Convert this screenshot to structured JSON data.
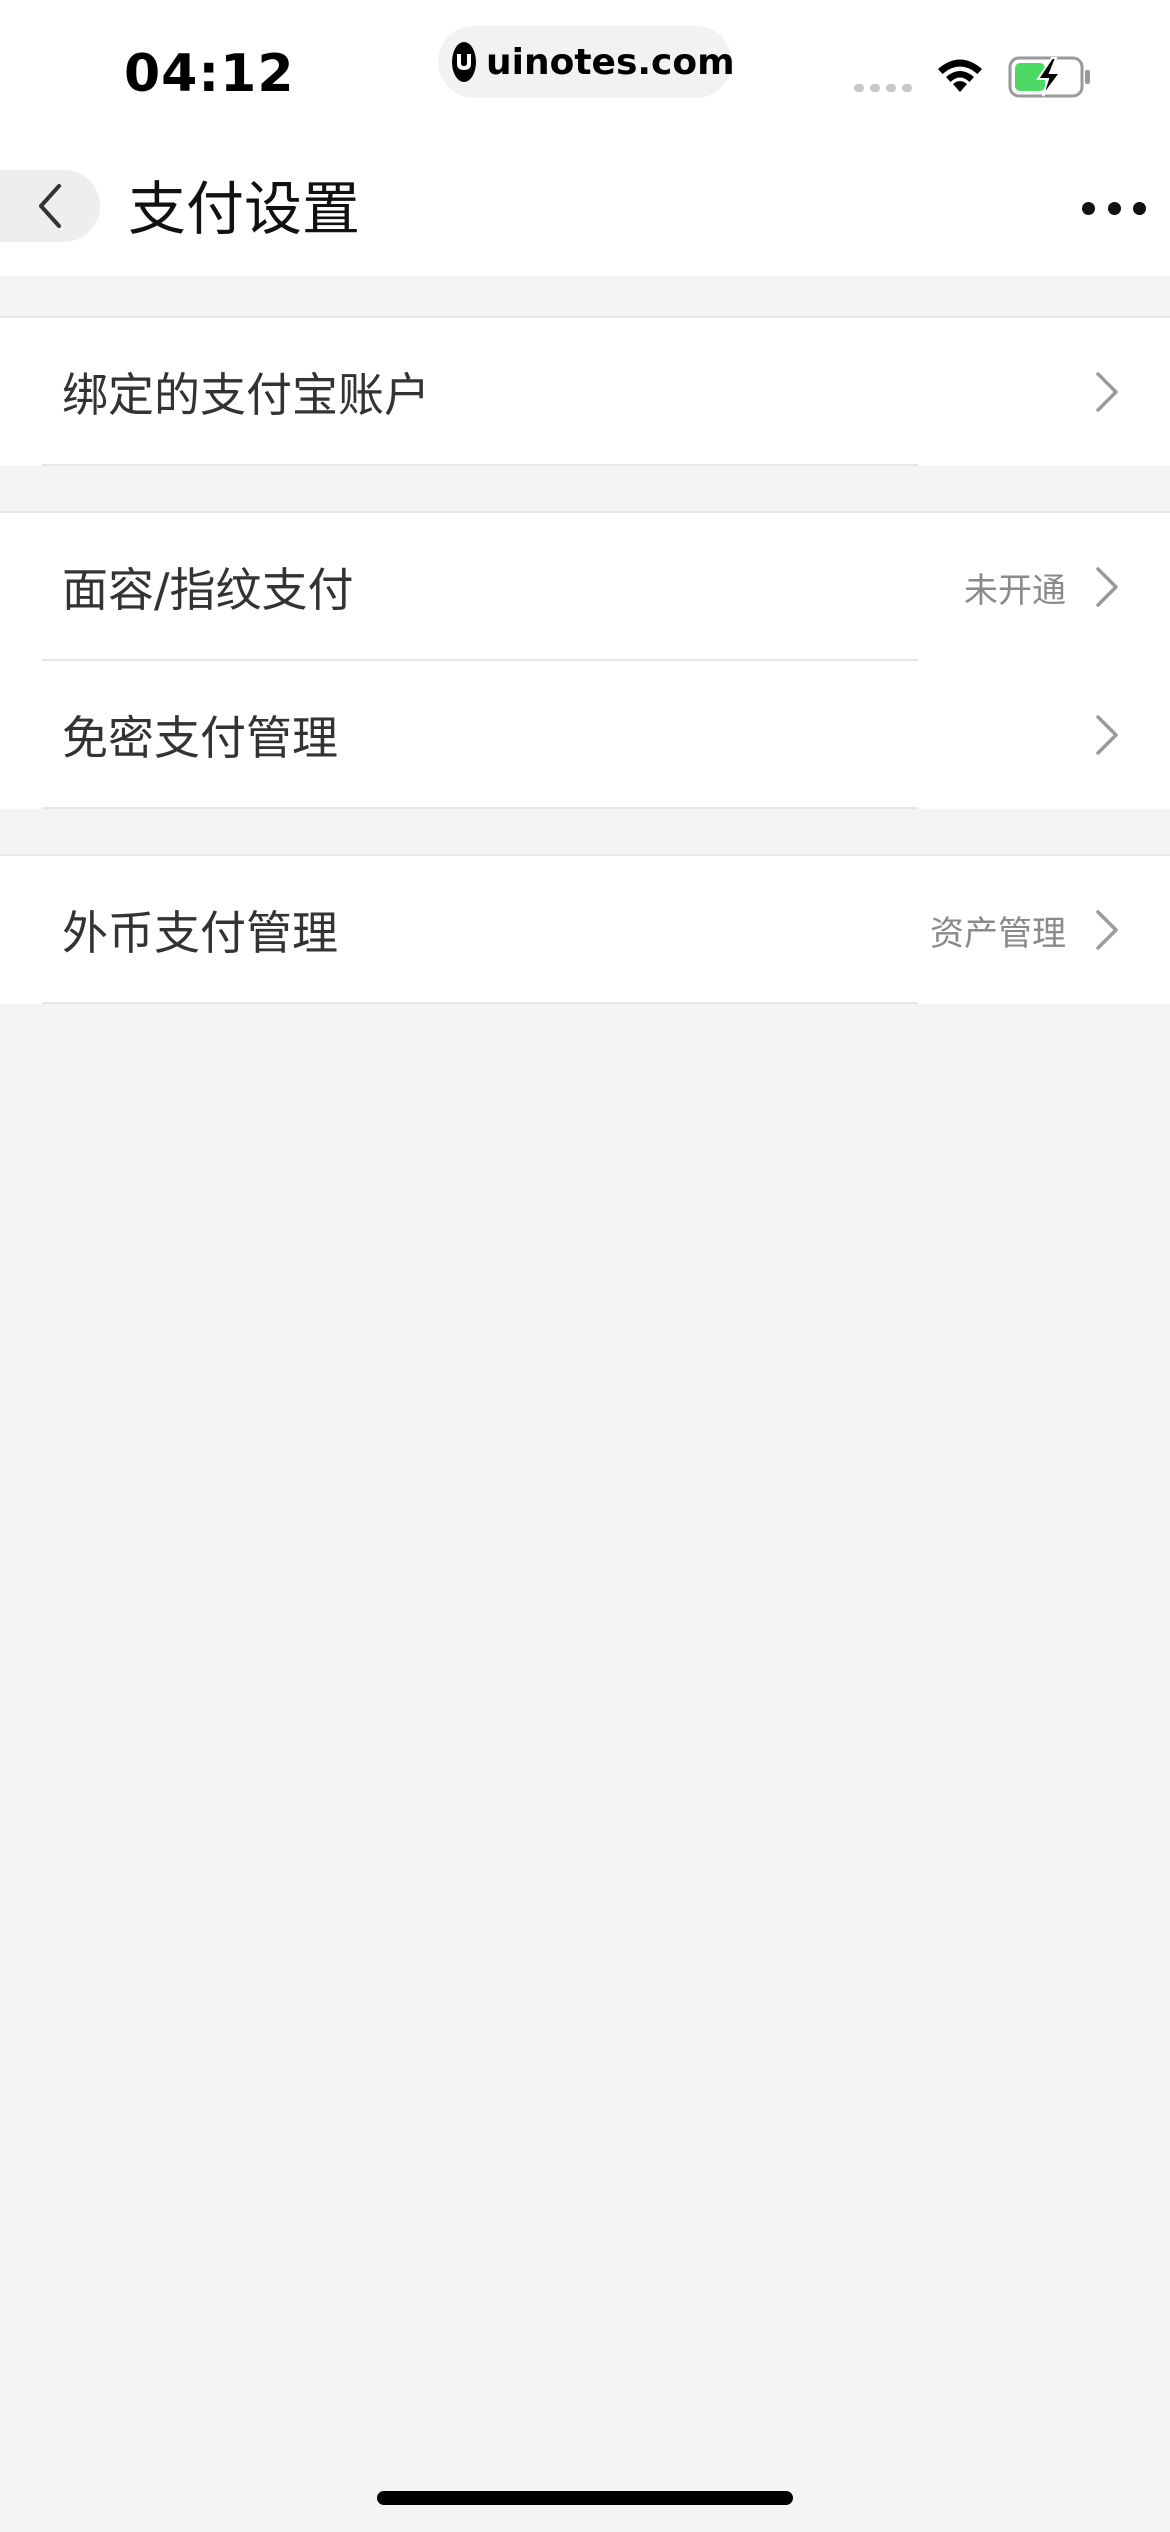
{
  "status_bar": {
    "time": "04:12",
    "watermark": "uinotes.com"
  },
  "nav": {
    "title": "支付设置",
    "back_icon": "chevron-left-icon",
    "more_icon": "more-dots-icon"
  },
  "groups": [
    {
      "rows": [
        {
          "label": "绑定的支付宝账户",
          "value": ""
        }
      ]
    },
    {
      "rows": [
        {
          "label": "面容/指纹支付",
          "value": "未开通"
        },
        {
          "label": "免密支付管理",
          "value": ""
        }
      ]
    },
    {
      "rows": [
        {
          "label": "外币支付管理",
          "value": "资产管理"
        }
      ]
    }
  ],
  "colors": {
    "background": "#f4f4f4",
    "surface": "#ffffff",
    "text": "#333333",
    "secondary_text": "#8a8a8a",
    "battery_green": "#4cd964"
  }
}
